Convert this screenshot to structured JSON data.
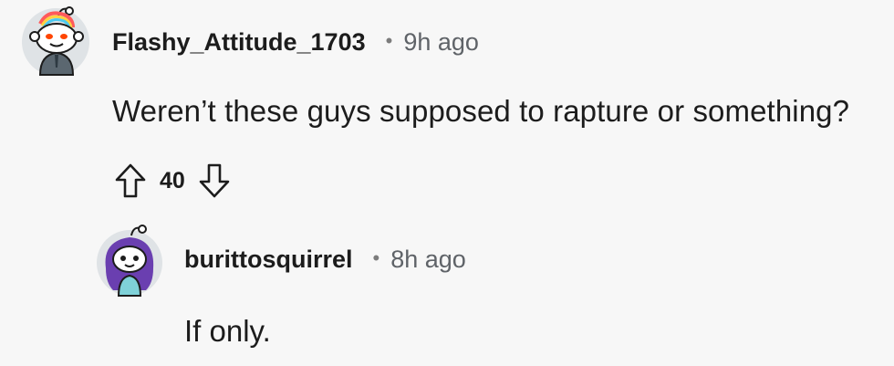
{
  "comments": [
    {
      "username": "Flashy_Attitude_1703",
      "separator": "•",
      "time": "9h ago",
      "body": "Weren’t these guys supposed to rapture or something?",
      "score": "40",
      "icons": {
        "upvote": "arrow-up-outline-icon",
        "downvote": "arrow-down-outline-icon"
      }
    },
    {
      "username": "burittosquirrel",
      "separator": "•",
      "time": "8h ago",
      "body": "If only."
    }
  ],
  "colors": {
    "background": "#f7f7f7",
    "text": "#1c1c1c",
    "muted": "#5f6368",
    "avatar_bg": "#dfe3e6",
    "avatar2_hair": "#6a3fb0"
  }
}
